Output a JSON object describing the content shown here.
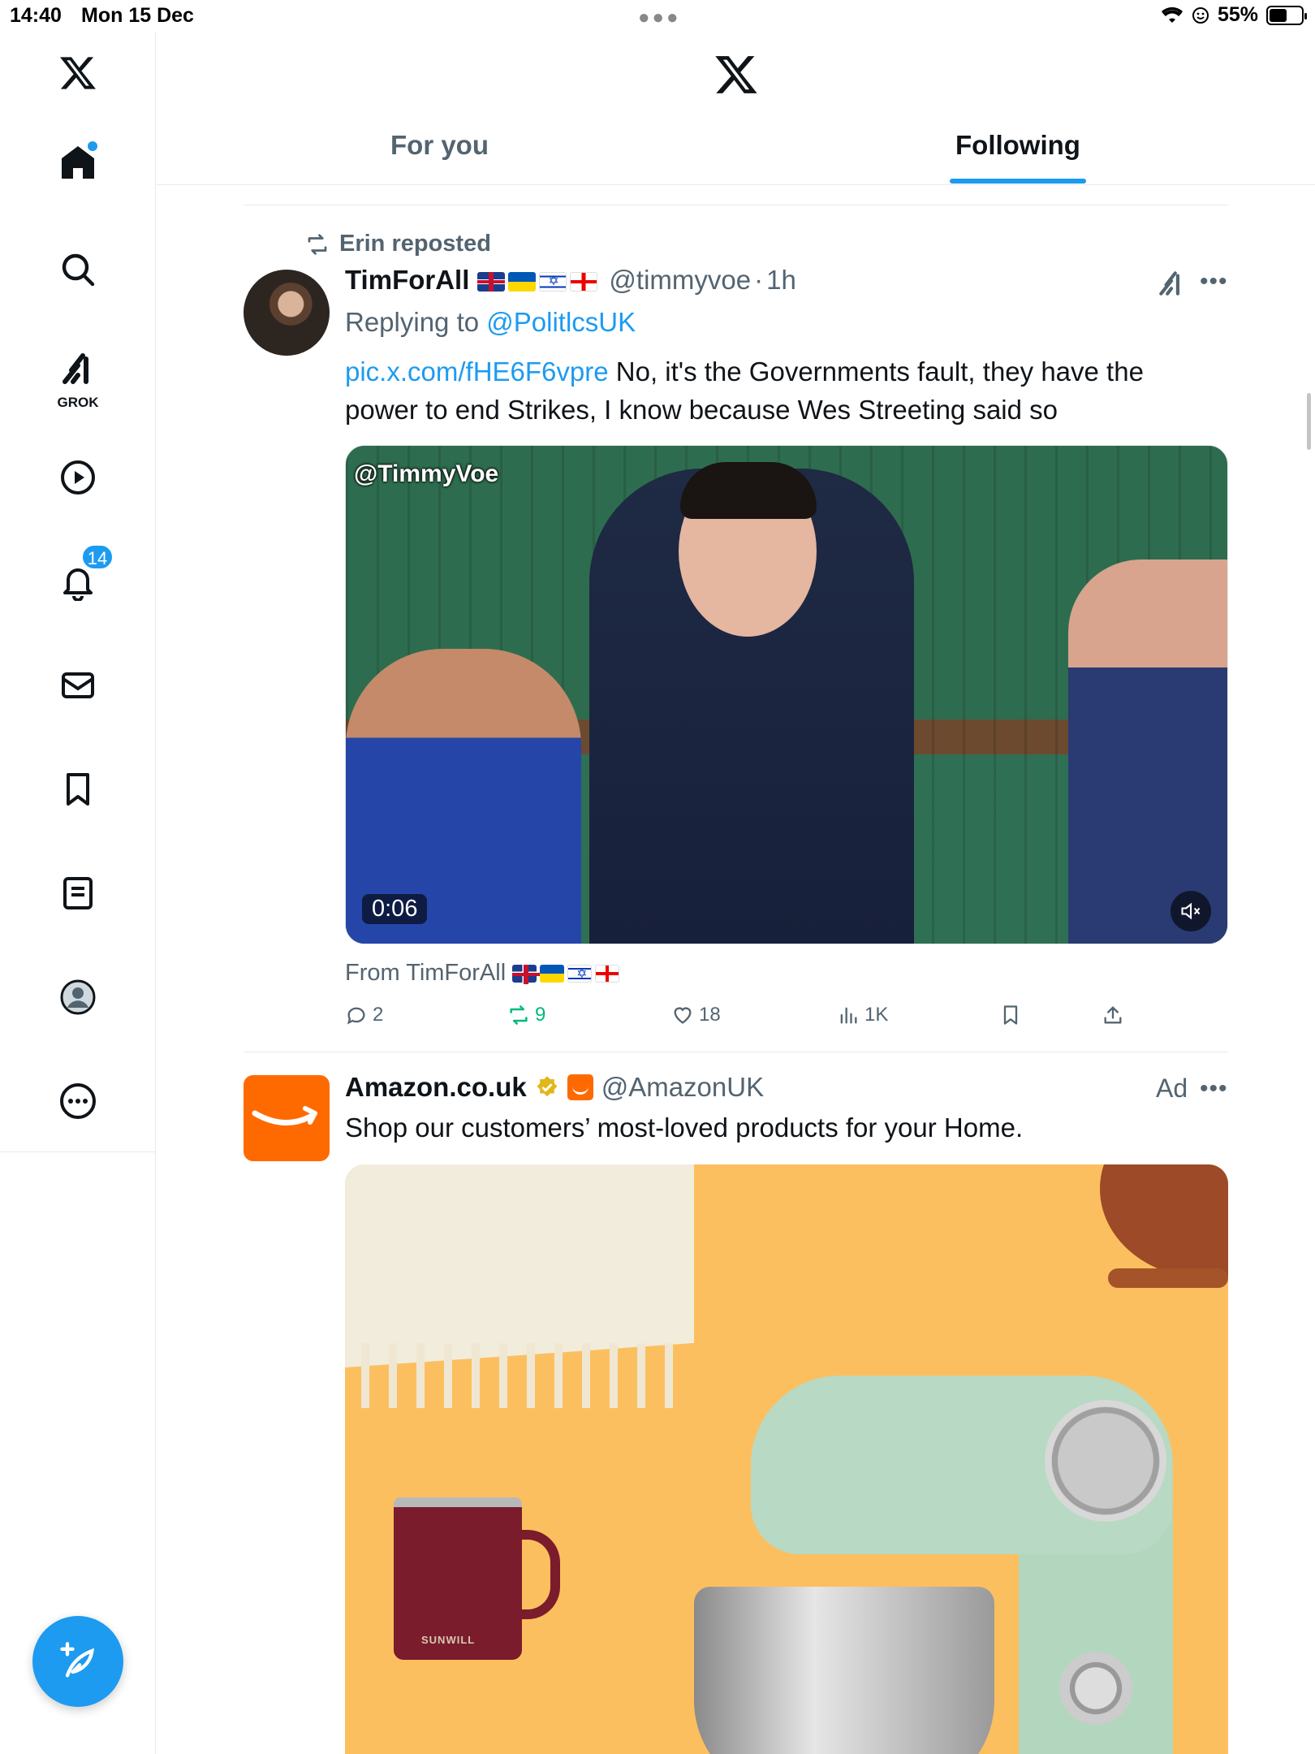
{
  "status_bar": {
    "time": "14:40",
    "date": "Mon 15 Dec",
    "battery": "55%",
    "battery_level": 0.55
  },
  "sidebar": {
    "grok_label": "GROK",
    "notifications_count": "14",
    "items": [
      "x-logo",
      "home-icon",
      "search-icon",
      "grok-icon",
      "video-icon",
      "notifications-icon",
      "messages-icon",
      "bookmarks-icon",
      "lists-icon",
      "profile-icon",
      "more-icon"
    ]
  },
  "header": {
    "tabs": [
      {
        "label": "For you",
        "active": false
      },
      {
        "label": "Following",
        "active": true
      }
    ]
  },
  "tweet": {
    "repost_by": "Erin reposted",
    "author_name": "TimForAll",
    "author_flags": [
      "uk",
      "ukraine",
      "israel",
      "georgia"
    ],
    "handle": "@timmyvoe",
    "separator": "·",
    "time": "1h",
    "replying_prefix": "Replying to",
    "replying_to": "@PolitlcsUK",
    "link": "pic.x.com/fHE6F6vpre",
    "text": " No, it's the Governments fault, they have the power to end Strikes, I know because Wes Streeting said so",
    "video": {
      "watermark": "@TimmyVoe",
      "duration": "0:06"
    },
    "from_label": "From TimForAll",
    "stats": {
      "replies": "2",
      "reposts": "9",
      "likes": "18",
      "views": "1K"
    }
  },
  "ad": {
    "author_name": "Amazon.co.uk",
    "handle": "@AmazonUK",
    "label": "Ad",
    "text": "Shop our customers’ most-loved products for your Home.",
    "mug_brand": "SUNWILL",
    "brand_color": "#ff6a00"
  },
  "colors": {
    "accent": "#1d9bf0",
    "repost_green": "#00ba7c",
    "muted": "#536471"
  }
}
